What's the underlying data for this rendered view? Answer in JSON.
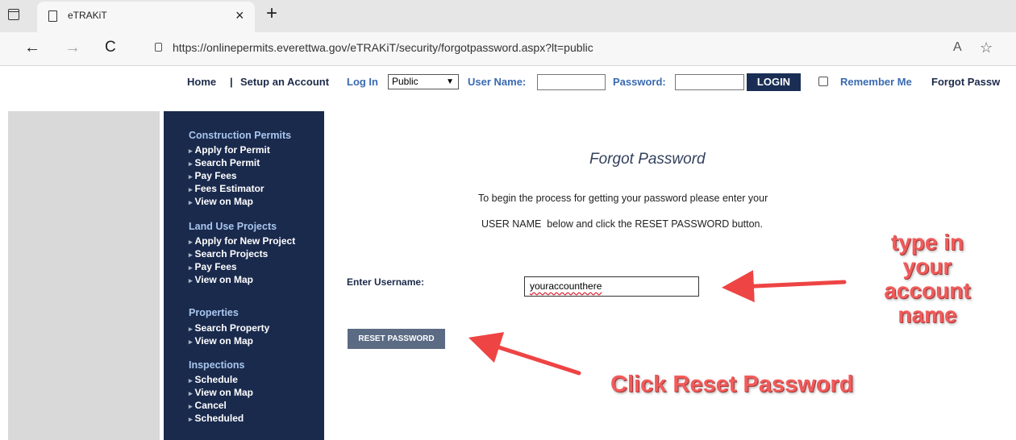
{
  "browser": {
    "tab_title": "eTRAKiT",
    "tab_close": "×",
    "new_tab": "+",
    "url": "https://onlinepermits.everettwa.gov/eTRAKiT/security/forgotpassword.aspx?lt=public",
    "back": "←",
    "forward": "→",
    "reload": "C",
    "read_aloud": "A",
    "favorites": "☆"
  },
  "loginbar": {
    "home": "Home",
    "separator": "|",
    "setup": "Setup an Account",
    "login_in": "Log In",
    "role_select": "Public",
    "username_label": "User Name:",
    "password_label": "Password:",
    "login_button": "LOGIN",
    "remember_me": "Remember Me",
    "forgot": "Forgot Passw"
  },
  "sidebar": {
    "sections": [
      {
        "heading": "Construction Permits",
        "items": [
          "Apply for Permit",
          "Search Permit",
          "Pay Fees",
          "Fees Estimator",
          "View on Map"
        ]
      },
      {
        "heading": "Land Use Projects",
        "items": [
          "Apply for New Project",
          "Search Projects",
          "Pay Fees",
          "View on Map"
        ]
      },
      {
        "heading": "Properties",
        "items": [
          "Search Property",
          "View on Map"
        ]
      },
      {
        "heading": "Inspections",
        "items": [
          "Schedule",
          "View on Map",
          "Cancel",
          "Scheduled"
        ]
      }
    ]
  },
  "main": {
    "title": "Forgot Password",
    "line1": "To begin the process for getting your password please enter your",
    "line2": "USER NAME  below and click the RESET PASSWORD button.",
    "enter_label": "Enter Username:",
    "username_value": "youraccounthere",
    "reset_button": "RESET PASSWORD"
  },
  "annotations": {
    "type_in_lines": [
      "type in",
      "your",
      "account",
      "name"
    ],
    "click_reset": "Click Reset Password",
    "color": "#f15b5b"
  }
}
